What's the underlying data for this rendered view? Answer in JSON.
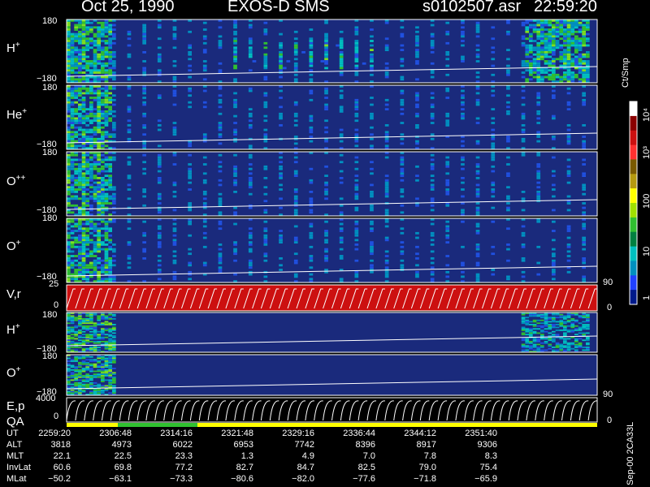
{
  "header": {
    "date": "Oct 25, 1990",
    "instrument": "EXOS-D SMS",
    "file": "s0102507.asr",
    "time": "22:59:20"
  },
  "panels": [
    {
      "label": "H",
      "sup": "+",
      "ymax": "180",
      "ymin": "−180",
      "kind": "spectrogram"
    },
    {
      "label": "He",
      "sup": "+",
      "ymax": "180",
      "ymin": "−180",
      "kind": "spectrogram"
    },
    {
      "label": "O",
      "sup": "++",
      "ymax": "180",
      "ymin": "−180",
      "kind": "spectrogram"
    },
    {
      "label": "O",
      "sup": "+",
      "ymax": "180",
      "ymin": "−180",
      "kind": "spectrogram",
      "right_tick": "90"
    },
    {
      "label": "V,r",
      "sup": "",
      "ymax": "25",
      "ymin": "0",
      "kind": "vr",
      "right_tick": "0"
    },
    {
      "label": "H",
      "sup": "+",
      "ymax": "180",
      "ymin": "−180",
      "kind": "spectrogram"
    },
    {
      "label": "O",
      "sup": "+",
      "ymax": "180",
      "ymin": "−180",
      "kind": "spectrogram"
    },
    {
      "label": "E,p",
      "sup": "",
      "ymax": "4000",
      "ymin": "0",
      "kind": "ep",
      "right_tick": "90",
      "right_tick2": "0"
    }
  ],
  "qa_label": "QA",
  "colorbar": {
    "unit": "Ct/Smp",
    "tick_labels": [
      "10⁴",
      "10³",
      "100",
      "10",
      "1"
    ],
    "colors": [
      "#ffffff",
      "#8b0000",
      "#cc1010",
      "#ff3030",
      "#7a5a00",
      "#b59a10",
      "#ffff00",
      "#a0e000",
      "#30c030",
      "#008040",
      "#00c0c0",
      "#0090c0",
      "#2040ff",
      "#001a8a"
    ]
  },
  "footer_code": "Sep-00  2CA33L",
  "table": {
    "rows": [
      {
        "label": "UT",
        "values": [
          "2259:20",
          "2306:48",
          "2314:16",
          "2321:48",
          "2329:16",
          "2336:44",
          "2344:12",
          "2351:40"
        ]
      },
      {
        "label": "ALT",
        "values": [
          "3818",
          "4973",
          "6022",
          "6953",
          "7742",
          "8396",
          "8917",
          "9306"
        ]
      },
      {
        "label": "MLT",
        "values": [
          "22.1",
          "22.5",
          "23.3",
          "1.3",
          "4.9",
          "7.0",
          "7.8",
          "8.3"
        ]
      },
      {
        "label": "InvLat",
        "values": [
          "60.6",
          "69.8",
          "77.2",
          "82.7",
          "84.7",
          "82.5",
          "79.0",
          "75.4"
        ]
      },
      {
        "label": "MLat",
        "values": [
          "−50.2",
          "−63.1",
          "−73.3",
          "−80.6",
          "−82.0",
          "−77.6",
          "−71.8",
          "−65.9"
        ]
      }
    ]
  },
  "chart_data": {
    "type": "heatmap",
    "title": "Oct 25, 1990   EXOS-D SMS",
    "x_tick_labels": [
      "2259:20",
      "2306:48",
      "2314:16",
      "2321:48",
      "2329:16",
      "2336:44",
      "2344:12",
      "2351:40"
    ],
    "y_range": [
      -180,
      180
    ],
    "colorbar_label": "Ct/Smp",
    "colorbar_ticks": [
      "1",
      "10",
      "100",
      "10³",
      "10⁴"
    ],
    "series": [
      {
        "name": "H+",
        "ylim": [
          -180,
          180
        ]
      },
      {
        "name": "He+",
        "ylim": [
          -180,
          180
        ]
      },
      {
        "name": "O++",
        "ylim": [
          -180,
          180
        ]
      },
      {
        "name": "O+",
        "ylim": [
          -180,
          180
        ]
      },
      {
        "name": "V,r",
        "ylim": [
          0,
          25
        ]
      },
      {
        "name": "H+",
        "ylim": [
          -180,
          180
        ]
      },
      {
        "name": "O+",
        "ylim": [
          -180,
          180
        ]
      },
      {
        "name": "E,p",
        "ylim": [
          0,
          4000
        ]
      }
    ]
  }
}
